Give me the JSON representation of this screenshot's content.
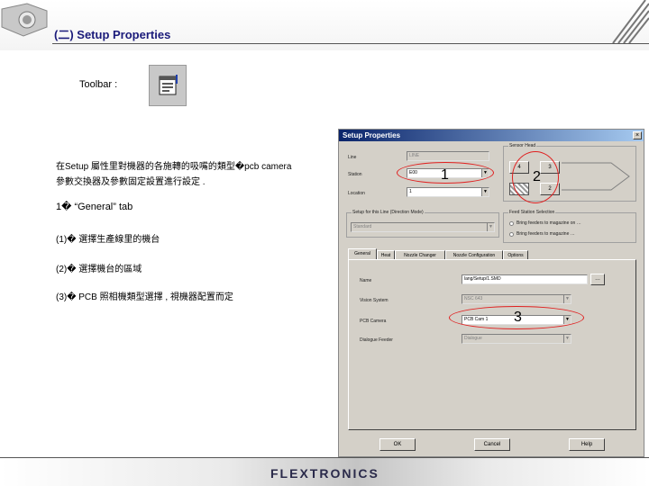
{
  "header": {
    "title": "(二) Setup Properties"
  },
  "left": {
    "toolbar_label": "Toolbar :",
    "desc_line1": "在Setup 屬性里對機器的各施轉的吸嘴的類型�pcb camera",
    "desc_line2": "參數交換器及參數固定設置進行設定 .",
    "item1": "1� “General” tab",
    "item1_1": "(1)� 選擇生產線里的機台",
    "item1_2": "(2)� 選擇機台的區域",
    "item1_3": "(3)� PCB 照相機類型選擇 , 視機器配置而定"
  },
  "dialog": {
    "title": "Setup Properties",
    "close": "×",
    "line_label": "Line",
    "line_value": "LINE",
    "station_label": "Station",
    "station_value": "E00",
    "location_label": "Location",
    "location_value": "1",
    "head_group": "Sensor Head",
    "head_btn1": "4",
    "head_btn2": "3",
    "head_btn3": "2",
    "setup_group": "Setup for this Line (Direction Mode)",
    "setup_value": "Standard",
    "feeder_group": "Feed Station Selection",
    "radio1": "Bring feeders to magazine on …",
    "radio2": "Bring feeders to magazine …",
    "tabs": [
      "General",
      "Heat",
      "Nozzle Changer",
      "Nozzle Configuration",
      "Options"
    ],
    "name_label": "Name",
    "name_value": "lang/Setup/1.SMD",
    "vision_label": "Vision System",
    "vision_value": "NSC 643",
    "pcb_label": "PCB Camera",
    "pcb_value": "PCB Cam 1",
    "feeder_label": "Dialogue Feeder",
    "feeder_value": "Dialogue",
    "ok": "OK",
    "cancel": "Cancel",
    "help": "Help"
  },
  "annotations": {
    "n1": "1",
    "n2": "2",
    "n3": "3"
  },
  "footer": {
    "logo": "FLEXTRONICS"
  }
}
